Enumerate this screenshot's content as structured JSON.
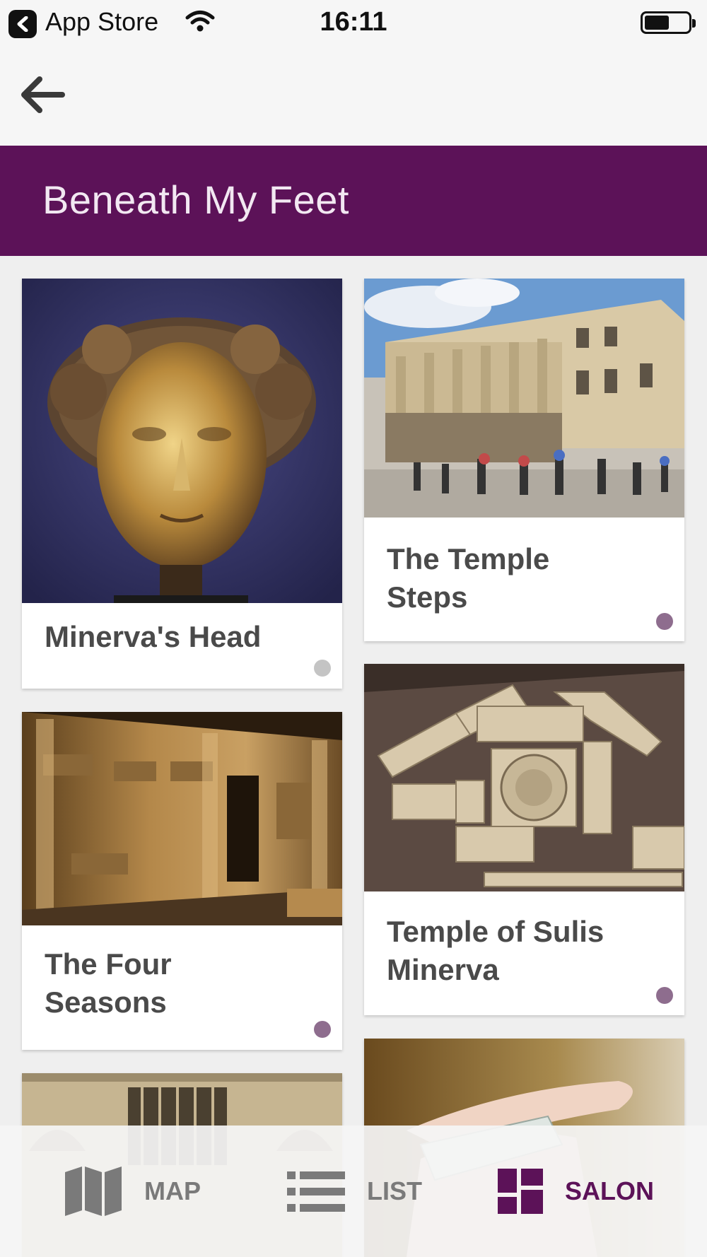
{
  "status_bar": {
    "back_app_label": "App Store",
    "time": "16:11"
  },
  "header": {
    "title": "Beneath My Feet"
  },
  "cards": [
    {
      "title_line1": "Minerva's Head",
      "title_line2": "",
      "image": "minerva-head-photo",
      "dot_color": "#c4c4c4"
    },
    {
      "title_line1": "The Temple",
      "title_line2": "Steps",
      "image": "temple-steps-photo",
      "dot_color": "#8e6d8e"
    },
    {
      "title_line1": "The Four",
      "title_line2": "Seasons",
      "image": "four-seasons-photo",
      "dot_color": "#8e6d8e"
    },
    {
      "title_line1": "Temple of Sulis",
      "title_line2": "Minerva",
      "image": "sulis-minerva-photo",
      "dot_color": "#8e6d8e"
    },
    {
      "title_line1": "",
      "title_line2": "",
      "image": "abbey-facade-photo"
    },
    {
      "title_line1": "",
      "title_line2": "",
      "image": "curse-tablet-photo"
    }
  ],
  "tabs": [
    {
      "label": "MAP",
      "icon": "map-icon",
      "active": false
    },
    {
      "label": "LIST",
      "icon": "list-icon",
      "active": false
    },
    {
      "label": "SALON",
      "icon": "grid-icon",
      "active": true
    }
  ],
  "colors": {
    "brand_purple": "#5c1258",
    "tab_inactive": "#7a7a7a",
    "tab_active": "#5c1258",
    "dot_purple": "#8e6d8e",
    "dot_grey": "#c4c4c4"
  }
}
